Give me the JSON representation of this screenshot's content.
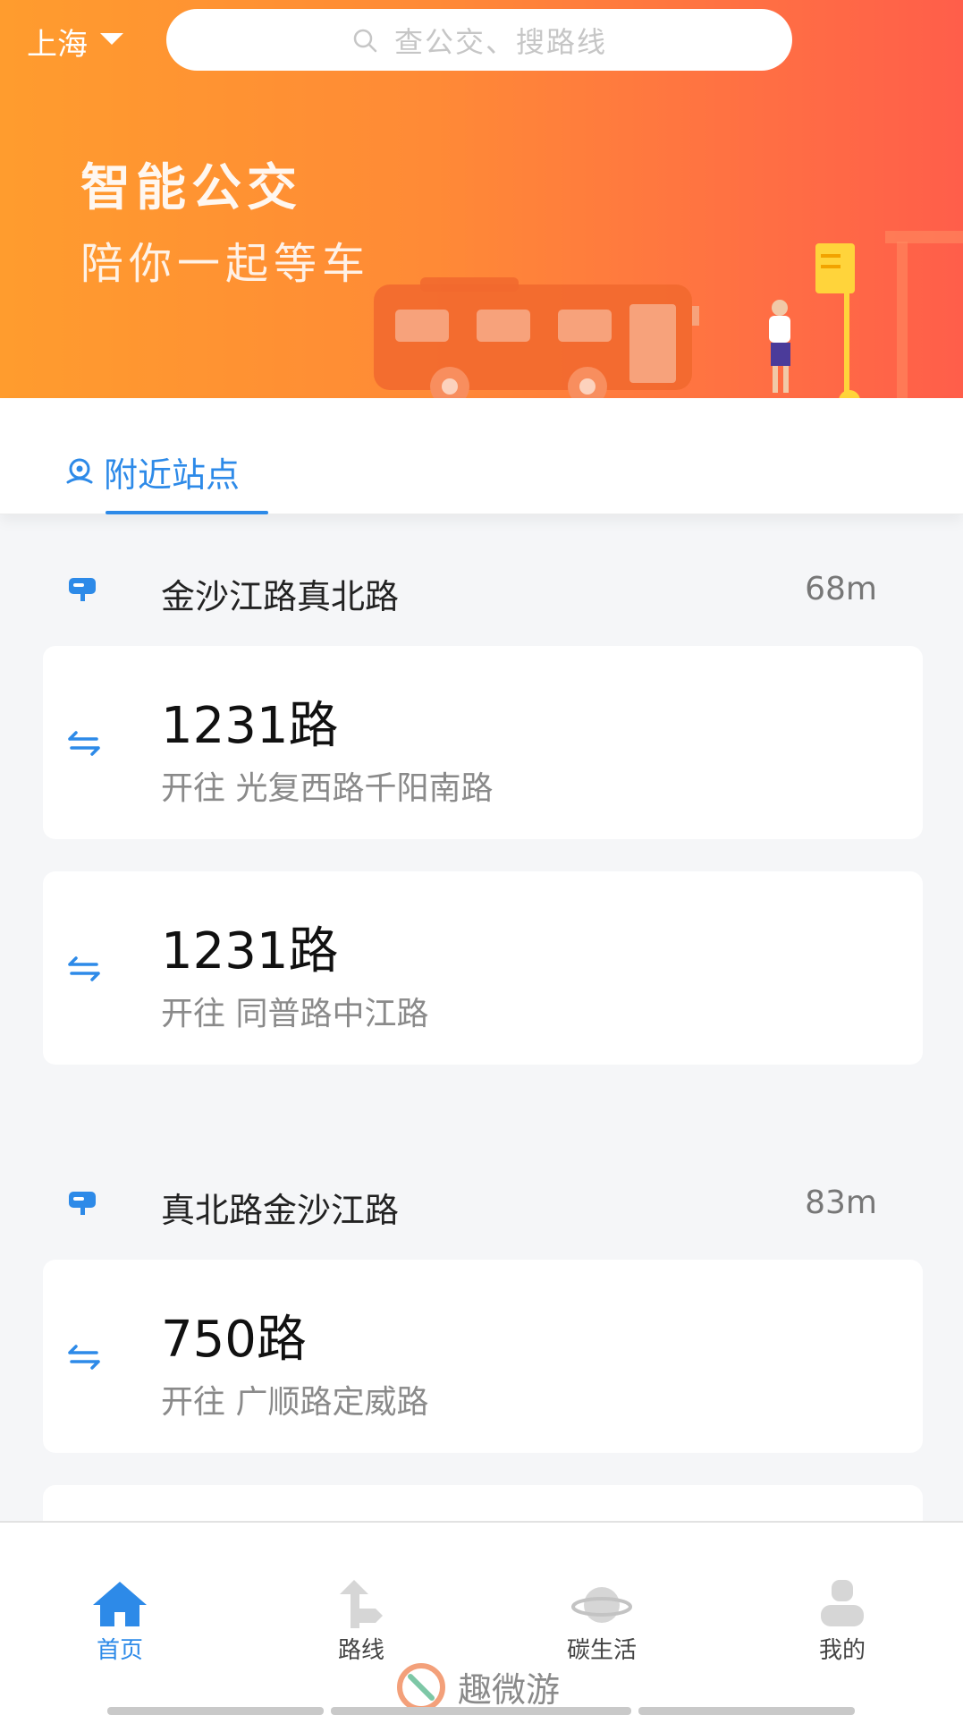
{
  "header": {
    "city": "上海",
    "search_placeholder": "查公交、搜路线",
    "slogan_line1": "智能公交",
    "slogan_line2": "陪你一起等车"
  },
  "tabs": [
    {
      "label": "附近站点",
      "active": true
    }
  ],
  "stations": [
    {
      "name": "金沙江路真北路",
      "distance": "68m",
      "routes": [
        {
          "route": "1231路",
          "direction": "开往 光复西路千阳南路"
        },
        {
          "route": "1231路",
          "direction": "开往 同普路中江路"
        }
      ]
    },
    {
      "name": "真北路金沙江路",
      "distance": "83m",
      "routes": [
        {
          "route": "750路",
          "direction": "开往 广顺路定威路"
        }
      ]
    }
  ],
  "bottom_nav": [
    {
      "label": "首页",
      "icon": "home-icon",
      "active": true
    },
    {
      "label": "路线",
      "icon": "route-sign-icon",
      "active": false
    },
    {
      "label": "碳生活",
      "icon": "planet-icon",
      "active": false
    },
    {
      "label": "我的",
      "icon": "user-icon",
      "active": false
    }
  ],
  "watermark": "趣微游",
  "colors": {
    "accent": "#2d8ae8",
    "header_start": "#ff9c2e",
    "header_end": "#ff5e4a"
  }
}
